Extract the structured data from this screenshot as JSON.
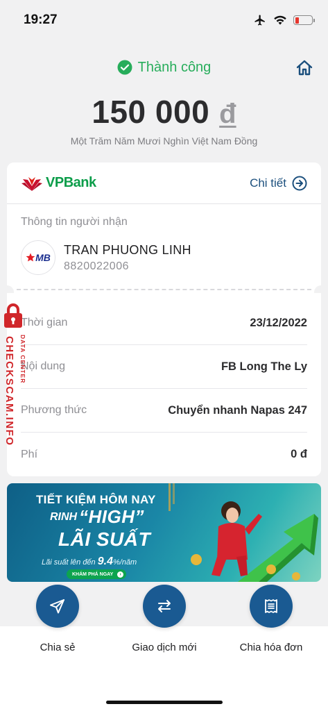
{
  "status_bar": {
    "time": "19:27"
  },
  "header": {
    "status_text": "Thành công"
  },
  "amount": {
    "value": "150 000",
    "currency": "đ",
    "in_words": "Một Trăm Năm Mươi Nghìn Việt Nam Đồng"
  },
  "sender_bank": {
    "logo_text_vp": "VP",
    "logo_text_bank": "Bank",
    "detail_label": "Chi tiết"
  },
  "recipient": {
    "section_label": "Thông tin người nhận",
    "bank_logo_text": "MB",
    "name": "TRAN PHUONG LINH",
    "account": "8820022006"
  },
  "details": [
    {
      "label": "Thời gian",
      "value": "23/12/2022"
    },
    {
      "label": "Nội dung",
      "value": "FB Long The Ly"
    },
    {
      "label": "Phương thức",
      "value": "Chuyển nhanh Napas 247"
    },
    {
      "label": "Phí",
      "value": "0 đ"
    }
  ],
  "banner": {
    "title": "TIẾT KIỆM HÔM NAY",
    "rinh": "RINH",
    "high": "“HIGH”",
    "lai_suat": "LÃI SUẤT",
    "sub_prefix": "Lãi suất lên đến",
    "sub_rate": "9.4",
    "sub_suffix": "%/năm",
    "cta": "KHÁM PHÁ NGAY"
  },
  "actions": [
    {
      "label": "Chia sẻ",
      "icon": "send-icon"
    },
    {
      "label": "Giao dịch mới",
      "icon": "swap-arrows-icon"
    },
    {
      "label": "Chia hóa đơn",
      "icon": "receipt-icon"
    }
  ],
  "watermark": {
    "brand": "CHECKSCAM.INFO",
    "sub": "DATA CENTER"
  },
  "colors": {
    "success_green": "#27ad5b",
    "primary_blue": "#1a5a92",
    "vpbank_green": "#0c9d4a",
    "watermark_red": "#d0262a"
  }
}
